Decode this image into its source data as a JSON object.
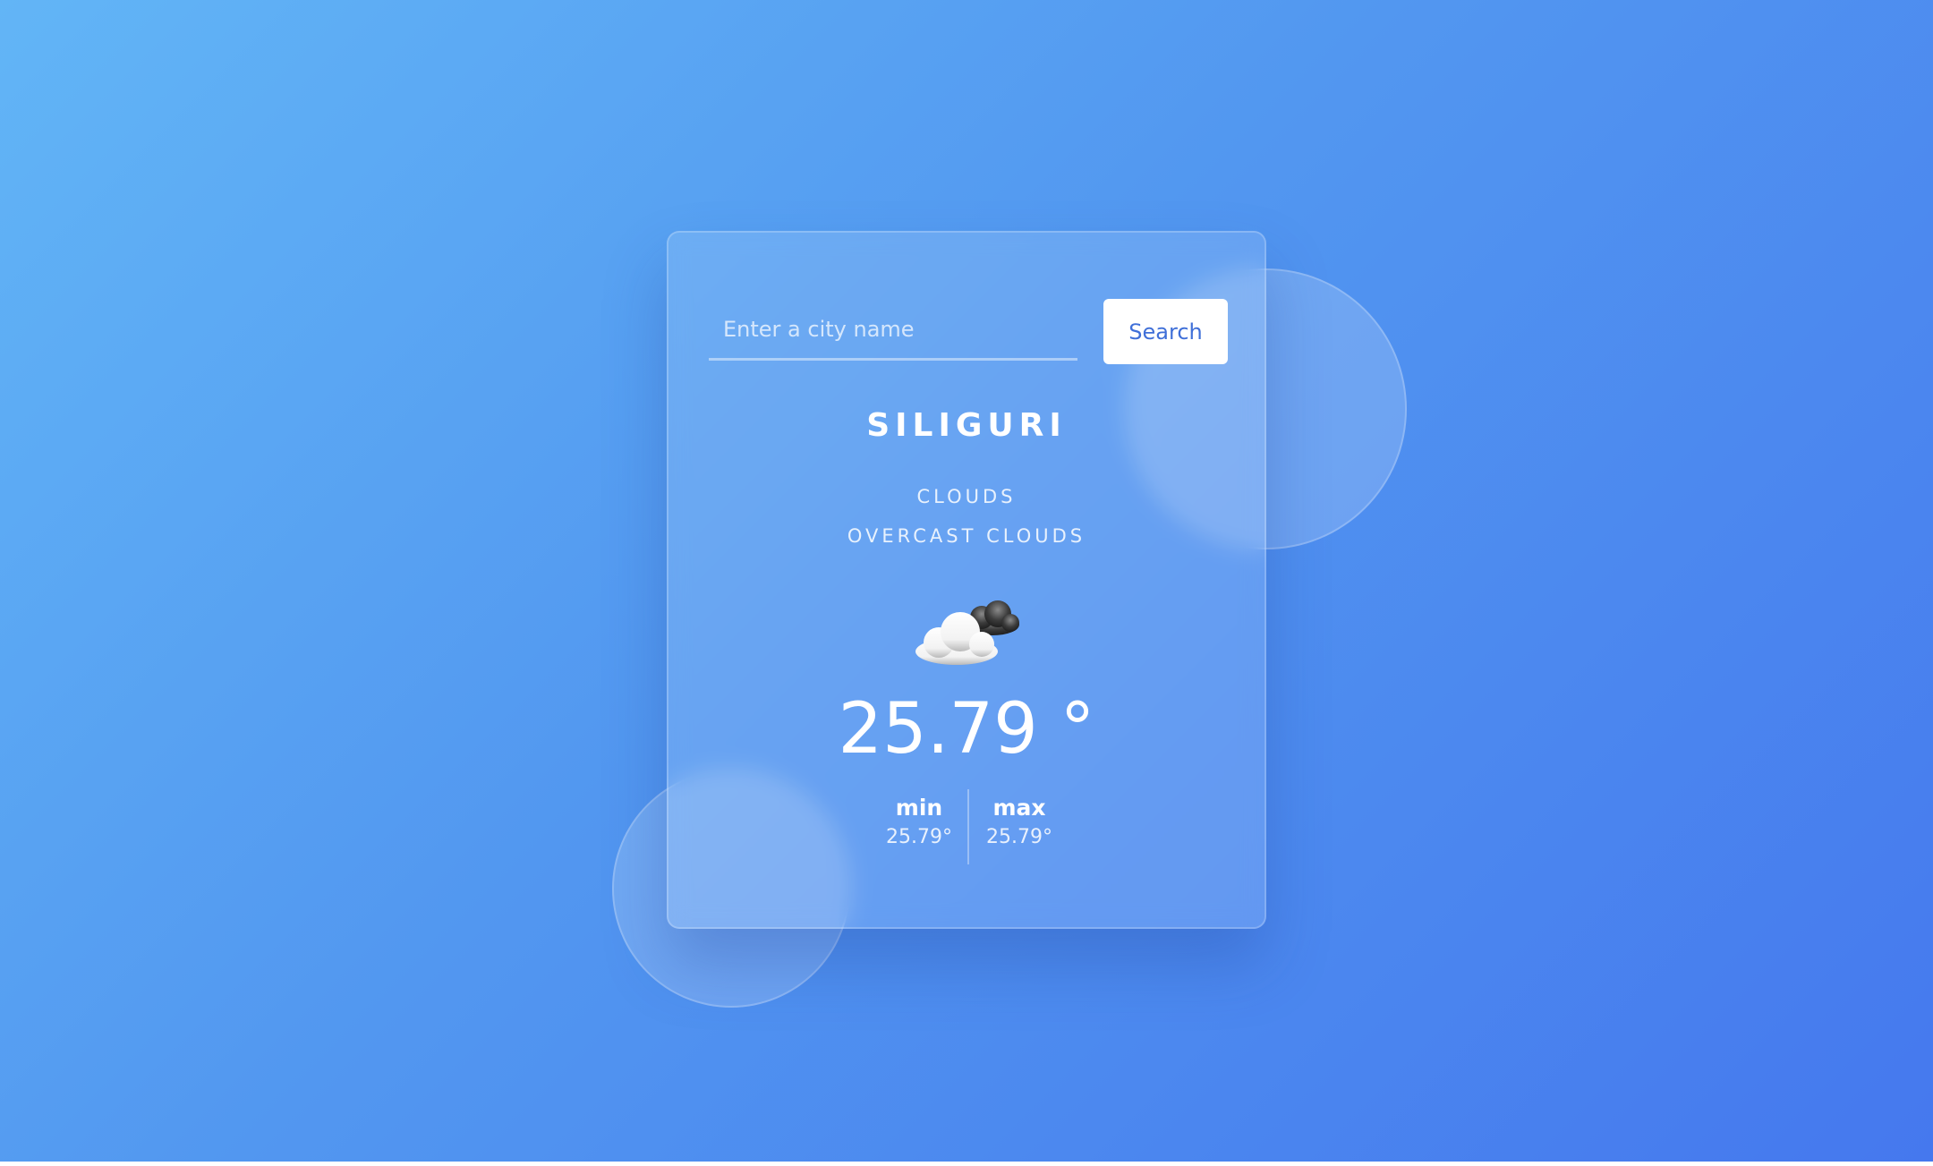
{
  "search": {
    "placeholder": "Enter a city name",
    "value": "",
    "button_label": "Search"
  },
  "weather": {
    "city": "SILIGURI",
    "main": "CLOUDS",
    "description": "OVERCAST CLOUDS",
    "icon": "overcast-clouds-icon",
    "temperature": "25.79 °",
    "min_label": "min",
    "min_value": "25.79°",
    "max_label": "max",
    "max_value": "25.79°"
  },
  "colors": {
    "background_start": "#62b5f6",
    "background_end": "#4578ee",
    "button_text": "#3f6fd8"
  }
}
